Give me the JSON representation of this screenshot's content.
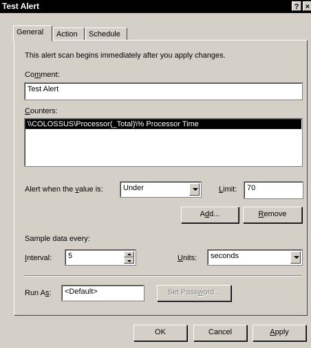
{
  "window": {
    "title": "Test Alert",
    "help_btn": "?",
    "close_btn": "×"
  },
  "tabs": [
    {
      "label": "General",
      "selected": true
    },
    {
      "label": "Action",
      "selected": false
    },
    {
      "label": "Schedule",
      "selected": false
    }
  ],
  "general": {
    "info_text": "This alert scan begins immediately after you apply changes.",
    "comment_label": {
      "before": "Co",
      "key": "m",
      "after": "ment:"
    },
    "comment_value": "Test Alert",
    "counters_label": {
      "before": "",
      "key": "C",
      "after": "ounters:"
    },
    "counters": [
      "\\\\COLOSSUS\\Processor(_Total)\\% Processor Time"
    ],
    "alert_when_label": {
      "before": "Alert when the ",
      "key": "v",
      "after": "alue is:"
    },
    "alert_when_value": "Under",
    "limit_label": {
      "before": "",
      "key": "L",
      "after": "imit:"
    },
    "limit_value": "70",
    "add_button": {
      "before": "A",
      "key": "d",
      "after": "d..."
    },
    "remove_button": {
      "before": "",
      "key": "R",
      "after": "emove"
    },
    "sample_label": "Sample data every:",
    "interval_label": {
      "before": "",
      "key": "I",
      "after": "nterval:"
    },
    "interval_value": "5",
    "units_label": {
      "before": "",
      "key": "U",
      "after": "nits:"
    },
    "units_value": "seconds",
    "run_as_label": {
      "before": "Run A",
      "key": "s",
      "after": ":"
    },
    "run_as_value": "<Default>",
    "set_password_button": {
      "before": "Set Pass",
      "key": "w",
      "after": "ord..."
    }
  },
  "footer": {
    "ok": "OK",
    "cancel": "Cancel",
    "apply": {
      "before": "",
      "key": "A",
      "after": "pply"
    }
  }
}
